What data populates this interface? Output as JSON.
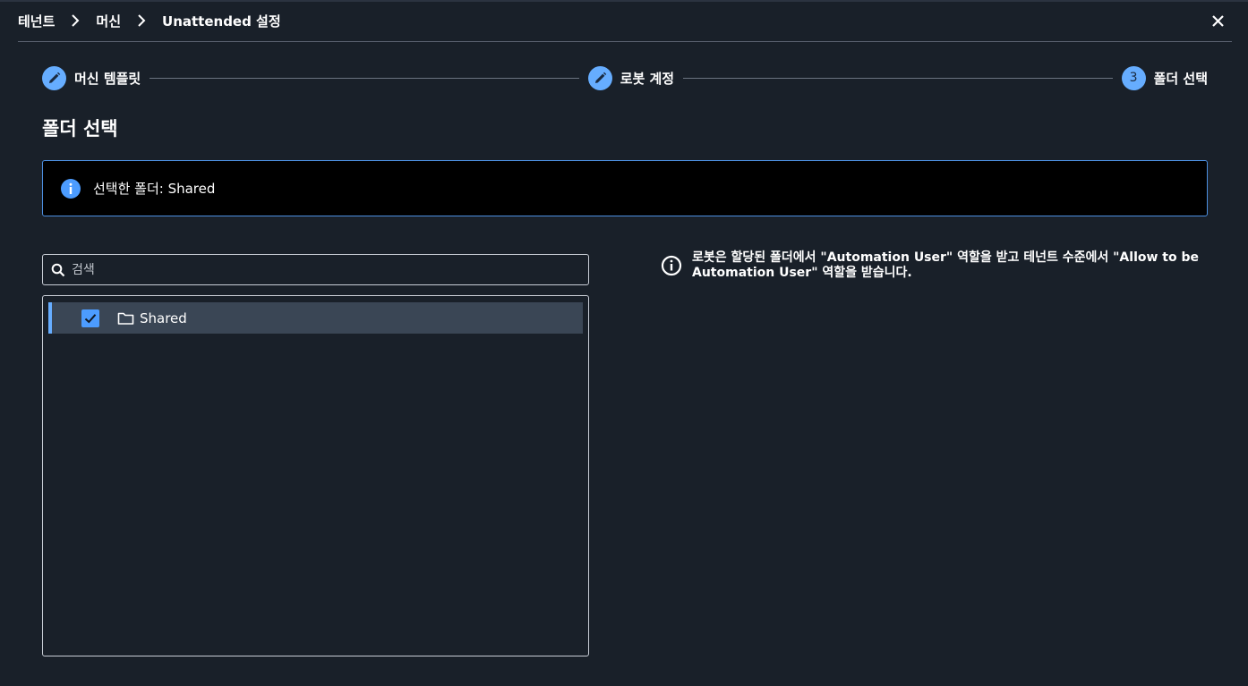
{
  "breadcrumb": {
    "items": [
      "테넌트",
      "머신",
      "Unattended 설정"
    ]
  },
  "header": {
    "close_icon": "close-icon"
  },
  "stepper": {
    "steps": [
      {
        "label": "머신 템플릿",
        "state": "completed",
        "icon": "pencil-icon"
      },
      {
        "label": "로봇 계정",
        "state": "completed",
        "icon": "pencil-icon"
      },
      {
        "label": "폴더 선택",
        "state": "current",
        "number": "3"
      }
    ]
  },
  "page": {
    "title": "폴더 선택"
  },
  "info_banner": {
    "text": "선택한 폴더: Shared",
    "icon": "info-icon"
  },
  "search": {
    "placeholder": "검색",
    "value": ""
  },
  "folder_tree": {
    "items": [
      {
        "name": "Shared",
        "checked": true,
        "selected": true,
        "icon": "folder-icon"
      }
    ]
  },
  "side_info": {
    "text": "로봇은 할당된 폴더에서 \"Automation User\" 역할을 받고 테넌트 수준에서 \"Allow to be Automation User\" 역할을 받습니다.",
    "icon": "info-outline-icon"
  },
  "colors": {
    "background": "#192029",
    "accent": "#66adff",
    "checkbox": "#4c9cff",
    "selected_row": "#3a4655",
    "banner_border": "#4c8fe0"
  }
}
